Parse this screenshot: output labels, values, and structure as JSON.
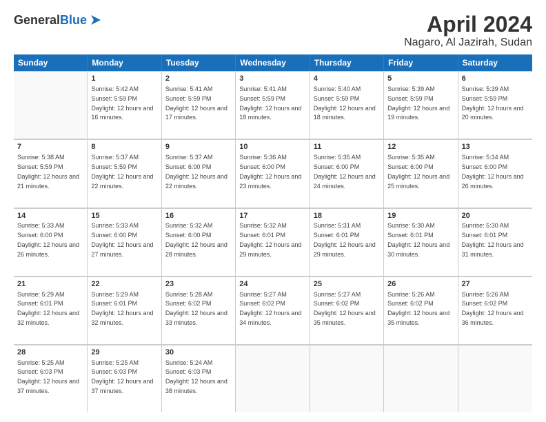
{
  "header": {
    "logo_general": "General",
    "logo_blue": "Blue",
    "title": "April 2024",
    "location": "Nagaro, Al Jazirah, Sudan"
  },
  "days_of_week": [
    "Sunday",
    "Monday",
    "Tuesday",
    "Wednesday",
    "Thursday",
    "Friday",
    "Saturday"
  ],
  "weeks": [
    [
      {
        "day": "",
        "empty": true
      },
      {
        "day": "1",
        "rise": "5:42 AM",
        "set": "5:59 PM",
        "daylight": "12 hours and 16 minutes."
      },
      {
        "day": "2",
        "rise": "5:41 AM",
        "set": "5:59 PM",
        "daylight": "12 hours and 17 minutes."
      },
      {
        "day": "3",
        "rise": "5:41 AM",
        "set": "5:59 PM",
        "daylight": "12 hours and 18 minutes."
      },
      {
        "day": "4",
        "rise": "5:40 AM",
        "set": "5:59 PM",
        "daylight": "12 hours and 18 minutes."
      },
      {
        "day": "5",
        "rise": "5:39 AM",
        "set": "5:59 PM",
        "daylight": "12 hours and 19 minutes."
      },
      {
        "day": "6",
        "rise": "5:39 AM",
        "set": "5:59 PM",
        "daylight": "12 hours and 20 minutes."
      }
    ],
    [
      {
        "day": "7",
        "rise": "5:38 AM",
        "set": "5:59 PM",
        "daylight": "12 hours and 21 minutes."
      },
      {
        "day": "8",
        "rise": "5:37 AM",
        "set": "5:59 PM",
        "daylight": "12 hours and 22 minutes."
      },
      {
        "day": "9",
        "rise": "5:37 AM",
        "set": "6:00 PM",
        "daylight": "12 hours and 22 minutes."
      },
      {
        "day": "10",
        "rise": "5:36 AM",
        "set": "6:00 PM",
        "daylight": "12 hours and 23 minutes."
      },
      {
        "day": "11",
        "rise": "5:35 AM",
        "set": "6:00 PM",
        "daylight": "12 hours and 24 minutes."
      },
      {
        "day": "12",
        "rise": "5:35 AM",
        "set": "6:00 PM",
        "daylight": "12 hours and 25 minutes."
      },
      {
        "day": "13",
        "rise": "5:34 AM",
        "set": "6:00 PM",
        "daylight": "12 hours and 26 minutes."
      }
    ],
    [
      {
        "day": "14",
        "rise": "5:33 AM",
        "set": "6:00 PM",
        "daylight": "12 hours and 26 minutes."
      },
      {
        "day": "15",
        "rise": "5:33 AM",
        "set": "6:00 PM",
        "daylight": "12 hours and 27 minutes."
      },
      {
        "day": "16",
        "rise": "5:32 AM",
        "set": "6:00 PM",
        "daylight": "12 hours and 28 minutes."
      },
      {
        "day": "17",
        "rise": "5:32 AM",
        "set": "6:01 PM",
        "daylight": "12 hours and 29 minutes."
      },
      {
        "day": "18",
        "rise": "5:31 AM",
        "set": "6:01 PM",
        "daylight": "12 hours and 29 minutes."
      },
      {
        "day": "19",
        "rise": "5:30 AM",
        "set": "6:01 PM",
        "daylight": "12 hours and 30 minutes."
      },
      {
        "day": "20",
        "rise": "5:30 AM",
        "set": "6:01 PM",
        "daylight": "12 hours and 31 minutes."
      }
    ],
    [
      {
        "day": "21",
        "rise": "5:29 AM",
        "set": "6:01 PM",
        "daylight": "12 hours and 32 minutes."
      },
      {
        "day": "22",
        "rise": "5:29 AM",
        "set": "6:01 PM",
        "daylight": "12 hours and 32 minutes."
      },
      {
        "day": "23",
        "rise": "5:28 AM",
        "set": "6:02 PM",
        "daylight": "12 hours and 33 minutes."
      },
      {
        "day": "24",
        "rise": "5:27 AM",
        "set": "6:02 PM",
        "daylight": "12 hours and 34 minutes."
      },
      {
        "day": "25",
        "rise": "5:27 AM",
        "set": "6:02 PM",
        "daylight": "12 hours and 35 minutes."
      },
      {
        "day": "26",
        "rise": "5:26 AM",
        "set": "6:02 PM",
        "daylight": "12 hours and 35 minutes."
      },
      {
        "day": "27",
        "rise": "5:26 AM",
        "set": "6:02 PM",
        "daylight": "12 hours and 36 minutes."
      }
    ],
    [
      {
        "day": "28",
        "rise": "5:25 AM",
        "set": "6:03 PM",
        "daylight": "12 hours and 37 minutes."
      },
      {
        "day": "29",
        "rise": "5:25 AM",
        "set": "6:03 PM",
        "daylight": "12 hours and 37 minutes."
      },
      {
        "day": "30",
        "rise": "5:24 AM",
        "set": "6:03 PM",
        "daylight": "12 hours and 38 minutes."
      },
      {
        "day": "",
        "empty": true
      },
      {
        "day": "",
        "empty": true
      },
      {
        "day": "",
        "empty": true
      },
      {
        "day": "",
        "empty": true
      }
    ]
  ]
}
